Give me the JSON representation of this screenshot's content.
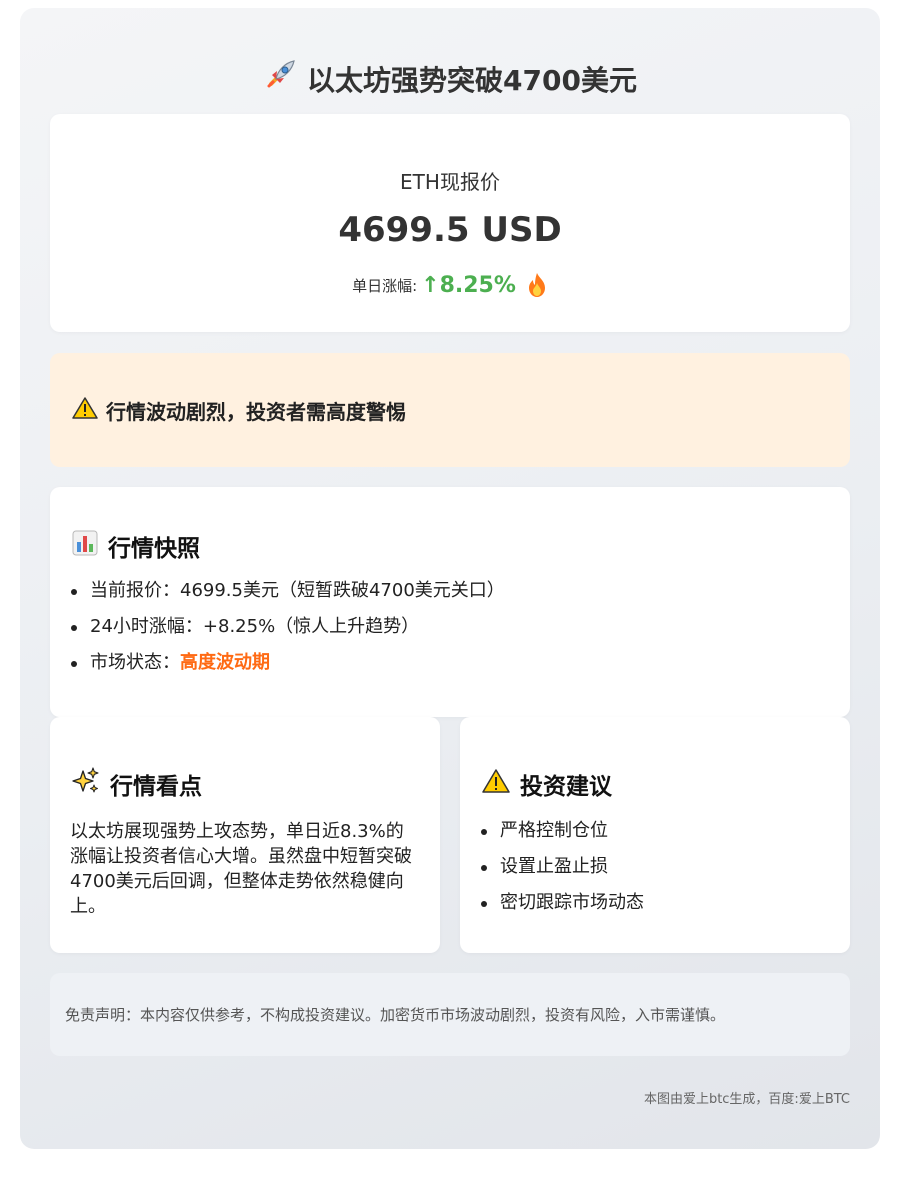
{
  "header": {
    "title": "以太坊强势突破4700美元",
    "icon": "rocket-icon"
  },
  "price_card": {
    "label": "ETH现报价",
    "value": "4699.5 USD",
    "change_label": "单日涨幅:",
    "change_value": "↑8.25%",
    "change_color": "#4caf50",
    "icon": "fire-icon"
  },
  "warning": {
    "icon": "warning-icon",
    "text": "行情波动剧烈，投资者需高度警惕",
    "background": "#fff1e0"
  },
  "snapshot": {
    "icon": "bar-chart-icon",
    "title": "行情快照",
    "items": [
      "当前报价：4699.5美元（短暂跌破4700美元关口）",
      "24小时涨幅：+8.25%（惊人上升趋势）"
    ],
    "status_label": "市场状态：",
    "status_value": "高度波动期",
    "status_color": "#ff6a13"
  },
  "highlights": {
    "icon": "sparkles-icon",
    "title": "行情看点",
    "text": "以太坊展现强势上攻态势，单日近8.3%的涨幅让投资者信心大增。虽然盘中短暂突破4700美元后回调，但整体走势依然稳健向上。"
  },
  "advice": {
    "icon": "warning-icon",
    "title": "投资建议",
    "items": [
      "严格控制仓位",
      "设置止盈止损",
      "密切跟踪市场动态"
    ]
  },
  "disclaimer": "免责声明：本内容仅供参考，不构成投资建议。加密货币市场波动剧烈，投资有风险，入市需谨慎。",
  "footer": "本图由爱上btc生成，百度:爱上BTC"
}
